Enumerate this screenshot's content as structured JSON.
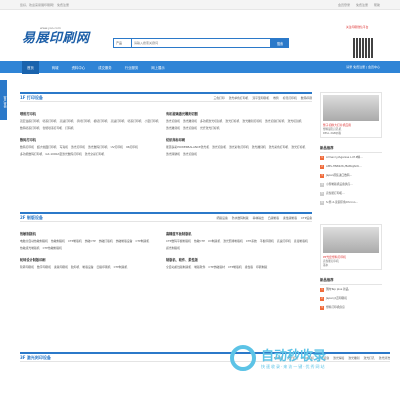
{
  "topbar": {
    "welcome": "您好，欢迎来易展印刷网！ 免费注册",
    "links": [
      "会员登录",
      "免费注册",
      "帮助"
    ]
  },
  "header": {
    "logo": "易展印刷网",
    "url": "www.yoo.com",
    "search_category": "产品",
    "search_placeholder": "请输入搜索关键词",
    "search_button": "搜索",
    "qr_label": "关注印刷微信平台"
  },
  "nav": {
    "items": [
      "首页",
      "商城",
      "资料中心",
      "成交服务",
      "行业服务",
      "网上展示"
    ],
    "right": "请录 免费注册 | 会员中心"
  },
  "sidetab": "客户咨询",
  "section1": {
    "title": "1F 打印设备",
    "links": [
      "三色打印",
      "激光单色打印机",
      "双平型印刷机",
      "卷筒",
      "标签打印机",
      "数码印刷"
    ],
    "groups": [
      {
        "title": "喷射打印机",
        "items": [
          "双层油墨打印机",
          "喷墨打印机",
          "高速打印机",
          "手持打印机",
          "模切打印机",
          "高速打印机",
          "喷墨打印机",
          "小型打印机",
          "数码喷墨打印机",
          "智能喷墨打印机",
          "打码机"
        ]
      },
      {
        "title": "有机玻璃激光雕刻切割",
        "items": [
          "激光切割机",
          "激光雕刻机",
          "多功能激光切割机",
          "激光打标机",
          "激光雕刻打标机",
          "激光切割打标机",
          "激光切割机",
          "激光雕刻机",
          "激光切割机",
          "光纤激光打标机"
        ]
      },
      {
        "title": "数码打印机",
        "items": [
          "数码打印机",
          "超大幅面打印机",
          "写真机",
          "激光打印机",
          "激光数码打印机",
          "UV打印机",
          "96打印机",
          "多功能数码打印机",
          "GX-1000A型激光数码打印机",
          "激光全彩打印机"
        ]
      },
      {
        "title": "纺织商标印刷",
        "items": [
          "能源多彩POWERBALANCE激光机",
          "激光切割机",
          "激光彩色打印机",
          "激光雕刻机",
          "激光彩色打印机",
          "激光打标机",
          "激光除锈机",
          "激光切割机"
        ]
      }
    ]
  },
  "section2": {
    "title": "2F 制版设备",
    "links": [
      "晒版设备",
      "防水数码制版",
      "菲林输出",
      "凸版制版",
      "柔性版制版",
      "CTP设备"
    ],
    "groups": [
      {
        "title": "热敏制版机",
        "items": [
          "电脑全自动热敏制版机",
          "热敏制版机",
          "CTP制版机",
          "热敏CTP",
          "热敏打版机",
          "热敏制版设备",
          "CTP制版机",
          "热敏感光制版机",
          "CTP热敏制版机"
        ]
      },
      {
        "title": "高精度平板制版机",
        "items": [
          "CTP数码平板制版机",
          "热敏CTP",
          "UV制版机",
          "激光照排制版机",
          "CTP系统",
          "平板印刷机",
          "高速打印机",
          "直接制版机",
          "感光制版机"
        ]
      },
      {
        "title": "轮转设计制版印刷",
        "items": [
          "轮转印刷机",
          "数字印刷机",
          "柔版印刷机",
          "胶印机",
          "制版设备",
          "凹版印刷机",
          "CTP制版机"
        ]
      },
      {
        "title": "制版机、软件、柔性版",
        "items": [
          "全自动柔性版制版机",
          "制版软件",
          "CTP热敏版材",
          "CTP制版机",
          "柔性版",
          "印刷制版"
        ]
      }
    ]
  },
  "section3": {
    "title": "3F 激光刻印设备",
    "links": [
      "3D雕刻",
      "光纤打标",
      "CO2打标",
      "激光切割",
      "激光焊接",
      "激光雕刻",
      "激光打孔",
      "激光清洗"
    ]
  },
  "aside1": {
    "img_caption": "整子切换大打片机应用",
    "sub": [
      "塑料锁孔打孔机",
      "DELL 2GB价格"
    ],
    "list_title": "新品推荐",
    "list": [
      "Armeccy/Aganise L.M.P精...",
      "AMS-HN8226 /BABAJACK...",
      "Japan原装进口数码...",
      "小型制版机设备供应...",
      "高性能打印机...",
      "S-塑-2-读圆带角Chrono..."
    ]
  },
  "aside2": {
    "img_caption": "PP光套塑料打印机",
    "sub": [
      "高性能打印机",
      "墨水"
    ],
    "list_title": "新品推荐",
    "list": [
      "国内Tep plus 新品",
      "Japan沙迈印刷机",
      "塑料打印机供应"
    ]
  },
  "watermark": {
    "main": "自动秒收录",
    "sub": "快速收录·来访一键·优秀网站"
  },
  "colors": {
    "brand": "#2b79c9",
    "nav": "#2f84d6",
    "accent_red": "#d33"
  }
}
